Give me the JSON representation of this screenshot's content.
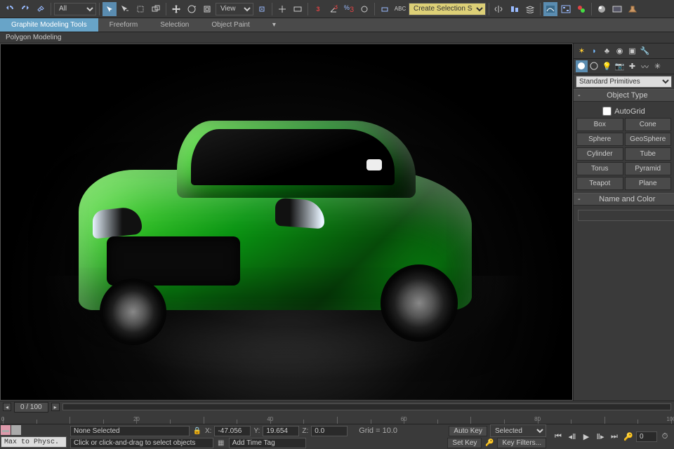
{
  "toolbar": {
    "filter_dropdown": "All",
    "view_dropdown": "View",
    "selection_set": "Create Selection Se"
  },
  "ribbon": {
    "tabs": [
      "Graphite Modeling Tools",
      "Freeform",
      "Selection",
      "Object Paint"
    ],
    "subpanel": "Polygon Modeling"
  },
  "cmd_panel": {
    "dropdown": "Standard Primitives",
    "rollouts": {
      "object_type": {
        "title": "Object Type",
        "autogrid": "AutoGrid",
        "buttons": [
          "Box",
          "Cone",
          "Sphere",
          "GeoSphere",
          "Cylinder",
          "Tube",
          "Torus",
          "Pyramid",
          "Teapot",
          "Plane"
        ]
      },
      "name_color": {
        "title": "Name and Color"
      }
    }
  },
  "timeline": {
    "frame_display": "0 / 100",
    "start": 0,
    "end": 100
  },
  "status": {
    "script_input": "Max to Physc.",
    "selection": "None Selected",
    "prompt": "Click or click-and-drag to select objects",
    "x_label": "X:",
    "x": "-47.056",
    "y_label": "Y:",
    "y": "19.654",
    "z_label": "Z:",
    "z": "0.0",
    "grid_label": "Grid = ",
    "grid": "10.0",
    "add_time_tag": "Add Time Tag",
    "auto_key": "Auto Key",
    "set_key": "Set Key",
    "selected": "Selected",
    "key_filters": "Key Filters..."
  }
}
